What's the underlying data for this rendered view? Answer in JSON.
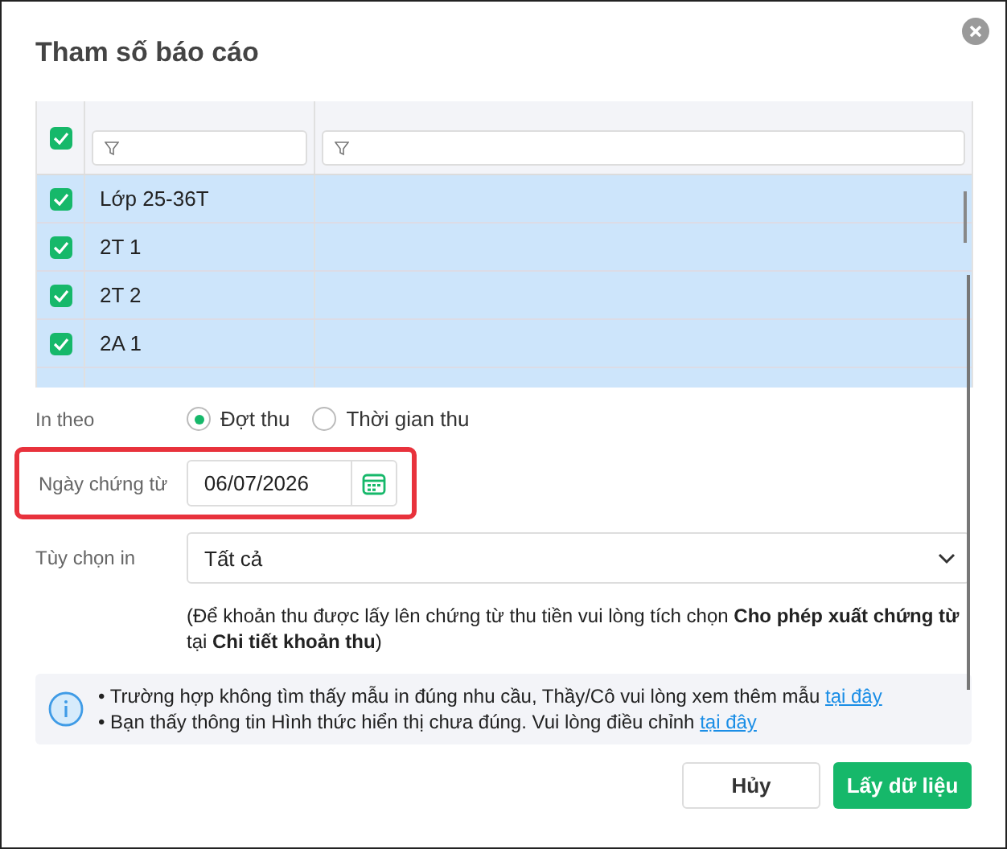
{
  "dialog": {
    "title": "Tham số báo cáo"
  },
  "table": {
    "header_checked": true,
    "rows": [
      {
        "name": "Lớp 25-36T",
        "checked": true,
        "selected": true
      },
      {
        "name": "2T 1",
        "checked": true,
        "selected": true
      },
      {
        "name": "2T 2",
        "checked": true,
        "selected": true
      },
      {
        "name": "2A 1",
        "checked": true,
        "selected": true
      }
    ]
  },
  "print_by": {
    "label": "In theo",
    "options": [
      {
        "label": "Đợt thu",
        "selected": true
      },
      {
        "label": "Thời gian thu",
        "selected": false
      }
    ]
  },
  "voucher_date": {
    "label": "Ngày chứng từ",
    "value": "06/07/2026",
    "highlighted": true
  },
  "print_option": {
    "label": "Tùy chọn in",
    "value": "Tất cả"
  },
  "note": "(Để khoản thu được lấy lên chứng từ thu tiền vui lòng tích chọn **Cho phép xuất chứng từ** tại **Chi tiết khoản thu**)",
  "info": [
    {
      "text": "• Trường hợp không tìm thấy mẫu in đúng nhu cầu, Thầy/Cô vui lòng xem thêm mẫu",
      "link": "tại đây"
    },
    {
      "text": "• Bạn thấy thông tin Hình thức hiển thị chưa đúng. Vui lòng điều chỉnh",
      "link": "tại đây"
    }
  ],
  "buttons": {
    "cancel": "Hủy",
    "submit": "Lấy dữ liệu"
  }
}
